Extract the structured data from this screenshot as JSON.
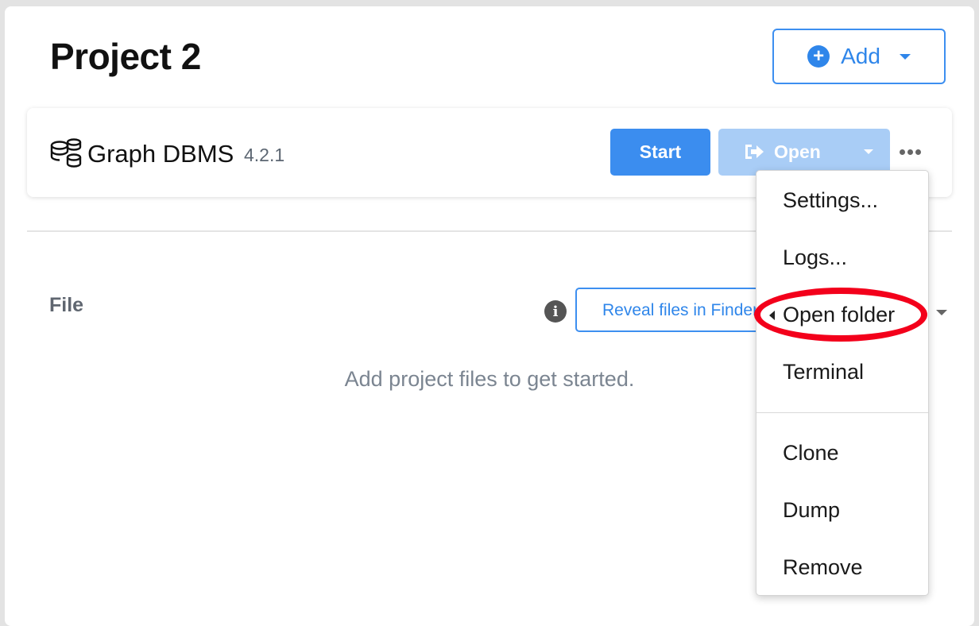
{
  "project": {
    "title": "Project 2"
  },
  "add_button": {
    "label": "Add",
    "icon": "plus-circle-icon"
  },
  "dbms": {
    "name": "Graph DBMS",
    "version": "4.2.1",
    "icon": "database-stack-icon",
    "start_label": "Start",
    "open_label": "Open",
    "open_icon": "sign-in-icon"
  },
  "files": {
    "heading": "File",
    "reveal_label": "Reveal files in Finder",
    "empty_message": "Add project files to get started."
  },
  "menu": {
    "items": [
      {
        "label": "Settings..."
      },
      {
        "label": "Logs..."
      },
      {
        "label": "Open folder"
      },
      {
        "label": "Terminal"
      },
      {
        "label": "Clone"
      },
      {
        "label": "Dump"
      },
      {
        "label": "Remove"
      }
    ]
  },
  "colors": {
    "primary": "#3b8def",
    "primary_disabled": "#a9cdf6",
    "highlight_ring": "#f3001b",
    "muted_text": "#7b8591"
  }
}
